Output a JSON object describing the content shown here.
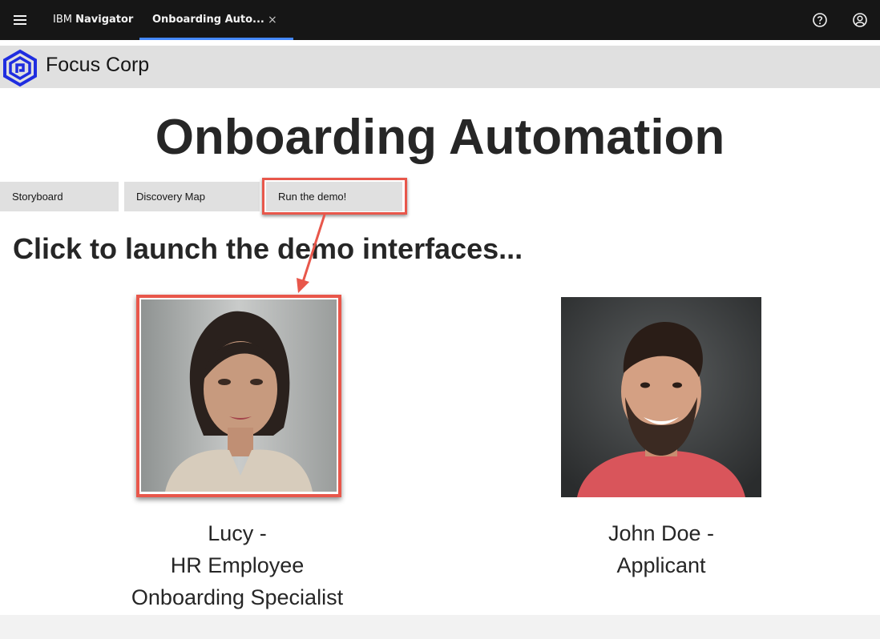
{
  "shell": {
    "brand_prefix": "IBM",
    "brand_name": "Navigator",
    "tab_label": "Onboarding Auto...",
    "tab_close": "×",
    "menu_icon": "hamburger-menu-icon",
    "help_icon": "help-circle-icon",
    "user_icon": "user-avatar-icon",
    "accent_color": "#4589ff"
  },
  "company": {
    "name": "Focus Corp",
    "logo_color": "#1f2de0"
  },
  "page": {
    "title": "Onboarding Automation",
    "heading": "Click to launch the demo interfaces..."
  },
  "nav": {
    "storyboard": "Storyboard",
    "discovery_map": "Discovery Map",
    "run_demo": "Run the demo!"
  },
  "people": {
    "lucy": {
      "line1": "Lucy -",
      "line2": "HR Employee",
      "line3": "Onboarding Specialist"
    },
    "john": {
      "line1": "John Doe -",
      "line2": "Applicant"
    }
  },
  "annotation_color": "#e8574b"
}
